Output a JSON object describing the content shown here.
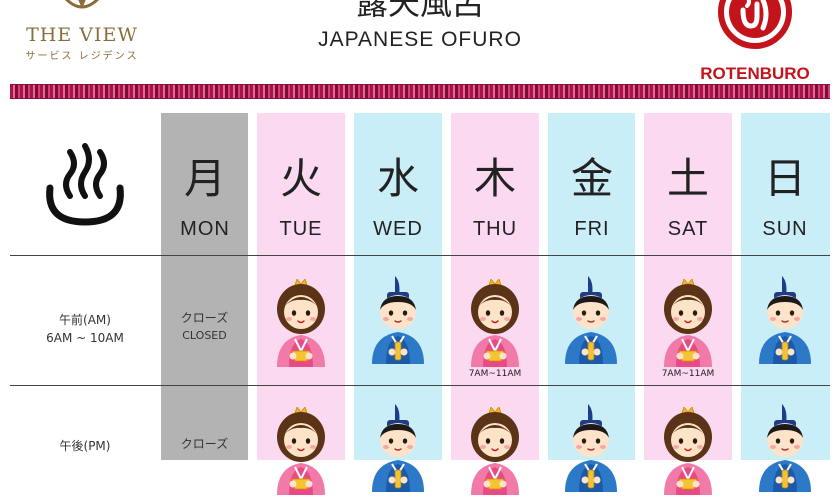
{
  "header": {
    "brand_name": "THE VIEW",
    "brand_sub": "サービス レジデンス",
    "title_jp": "露天風呂",
    "title_en": "JAPANESE OFURO",
    "badge_text": "ROTENBURO"
  },
  "colors": {
    "closed": "#b3b3b3",
    "pink": "#fbd9f1",
    "blue": "#c9eef8",
    "badge_red": "#c3141b",
    "brand_gold": "#8a6d3b"
  },
  "days": [
    {
      "kanji": "月",
      "en": "MON"
    },
    {
      "kanji": "火",
      "en": "TUE"
    },
    {
      "kanji": "水",
      "en": "WED"
    },
    {
      "kanji": "木",
      "en": "THU"
    },
    {
      "kanji": "金",
      "en": "FRI"
    },
    {
      "kanji": "土",
      "en": "SAT"
    },
    {
      "kanji": "日",
      "en": "SUN"
    }
  ],
  "rows": {
    "am": {
      "label_jp": "午前(AM)",
      "hours": "6AM ~ 10AM"
    },
    "pm": {
      "label_jp": "午後(PM)"
    }
  },
  "closed": {
    "jp": "クローズ",
    "en": "CLOSED"
  },
  "notes": {
    "thu_am": "7AM~11AM",
    "sat_am": "7AM~11AM"
  },
  "icons": {
    "onsen": "hot-spring-icon",
    "female_doll": "female-doll-icon",
    "male_doll": "male-doll-icon"
  }
}
